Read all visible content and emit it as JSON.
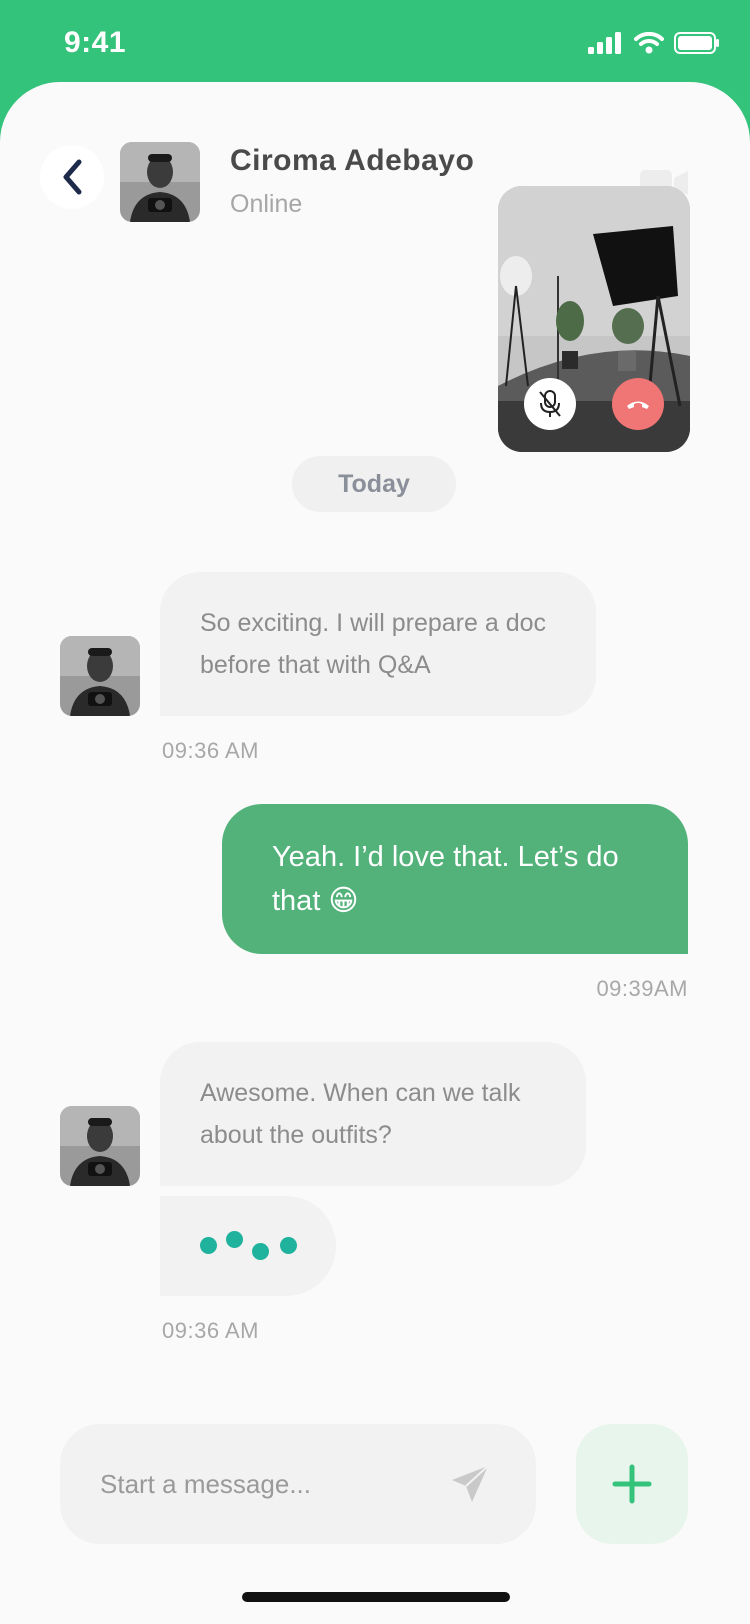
{
  "status_bar": {
    "time": "9:41"
  },
  "header": {
    "back_label": "Back",
    "contact_name": "Ciroma Adebayo",
    "contact_status": "Online"
  },
  "date_divider": "Today",
  "messages": [
    {
      "direction": "incoming",
      "text": "So exciting. I will prepare a doc before that with Q&A",
      "time": "09:36 AM"
    },
    {
      "direction": "outgoing",
      "text": "Yeah. I’d love that. Let’s do that 😁",
      "time": "09:39AM"
    },
    {
      "direction": "incoming",
      "text": "Awesome. When can we talk about the outfits?",
      "time": "09:36 AM"
    }
  ],
  "composer": {
    "placeholder": "Start a message..."
  },
  "colors": {
    "brand": "#34C37A",
    "outgoing_bubble": "#52B27A",
    "typing_dot": "#1FB39E",
    "end_call": "#F07575",
    "background": "#FAFAFA"
  }
}
